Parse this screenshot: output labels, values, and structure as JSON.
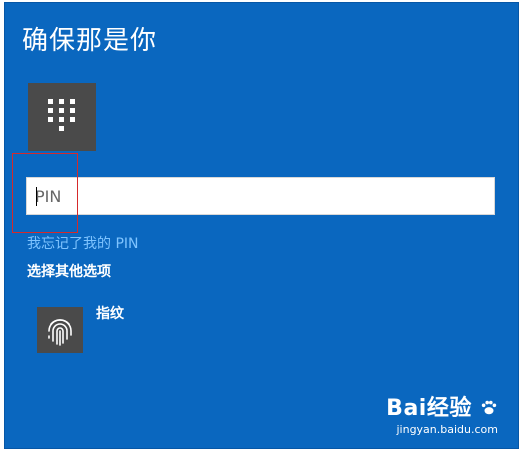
{
  "dialog": {
    "title": "确保那是你"
  },
  "pin_sign_in": {
    "icon": "keypad-icon",
    "input_value": "",
    "input_placeholder": "PIN"
  },
  "links": {
    "forgot_pin": "我忘记了我的 PIN",
    "other_options": "选择其他选项"
  },
  "sign_in_options": [
    {
      "icon": "fingerprint-icon",
      "label": "指纹"
    }
  ],
  "watermark": {
    "logo": "Bai经验",
    "url": "jingyan.baidu.com"
  },
  "colors": {
    "background": "#0a67bf",
    "tile": "#4a4a4a",
    "link": "#7fc4ff",
    "highlight_box": "#d62a2a"
  }
}
